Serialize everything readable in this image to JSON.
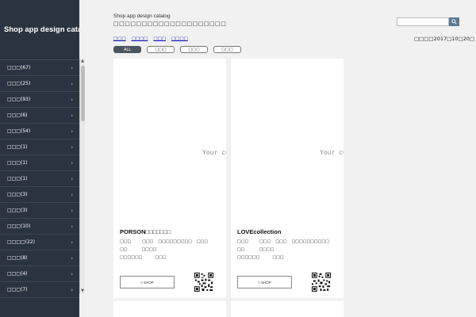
{
  "sidebar": {
    "title": "Shop app design catalog",
    "items": [
      {
        "label": "□□□(67)"
      },
      {
        "label": "□□□(25)"
      },
      {
        "label": "□□□(93)"
      },
      {
        "label": "□□□(6)"
      },
      {
        "label": "□□□(54)"
      },
      {
        "label": "□□□(1)"
      },
      {
        "label": "□□□(1)"
      },
      {
        "label": "□□□(1)"
      },
      {
        "label": "□□□(3)"
      },
      {
        "label": "□□□(3)"
      },
      {
        "label": "□□□(10)"
      },
      {
        "label": "□□□□(22)"
      },
      {
        "label": "□□□(8)"
      },
      {
        "label": "□□□(4)"
      },
      {
        "label": "□□□(7)"
      }
    ],
    "chevron": "›",
    "scroll_up": "▲",
    "scroll_down": "▼"
  },
  "header": {
    "site_name": "Shop app design catalog",
    "site_sub": "□□□□□□□□□□□□□□□□□□□□",
    "search_placeholder": "",
    "search_icon": "search-icon"
  },
  "nav": {
    "links": [
      "□□□",
      "□□□□",
      "□□□",
      "□□□□"
    ],
    "date": "□□□□2017□10□20□"
  },
  "filters": [
    "ALL",
    "□□□",
    "□□□",
    "□□□"
  ],
  "cards": [
    {
      "image_text": "Your cu",
      "name": "PORSON□□□□□□□",
      "info": [
        [
          "□□□",
          "□□□",
          "□□□□□□□□□",
          "□□□"
        ],
        [
          "□□",
          "□□□□"
        ],
        [
          "□□□□□□",
          "□□□"
        ]
      ],
      "shop_label": "> SHOP"
    },
    {
      "image_text": "Your cu",
      "name": "LOVEcollection",
      "info": [
        [
          "□□□",
          "□□□",
          "□□□",
          "□□□□□□□□□□"
        ],
        [
          "□□",
          "□□□□"
        ],
        [
          "□□□□□□",
          "□□□"
        ]
      ],
      "shop_label": "> SHOP"
    }
  ]
}
